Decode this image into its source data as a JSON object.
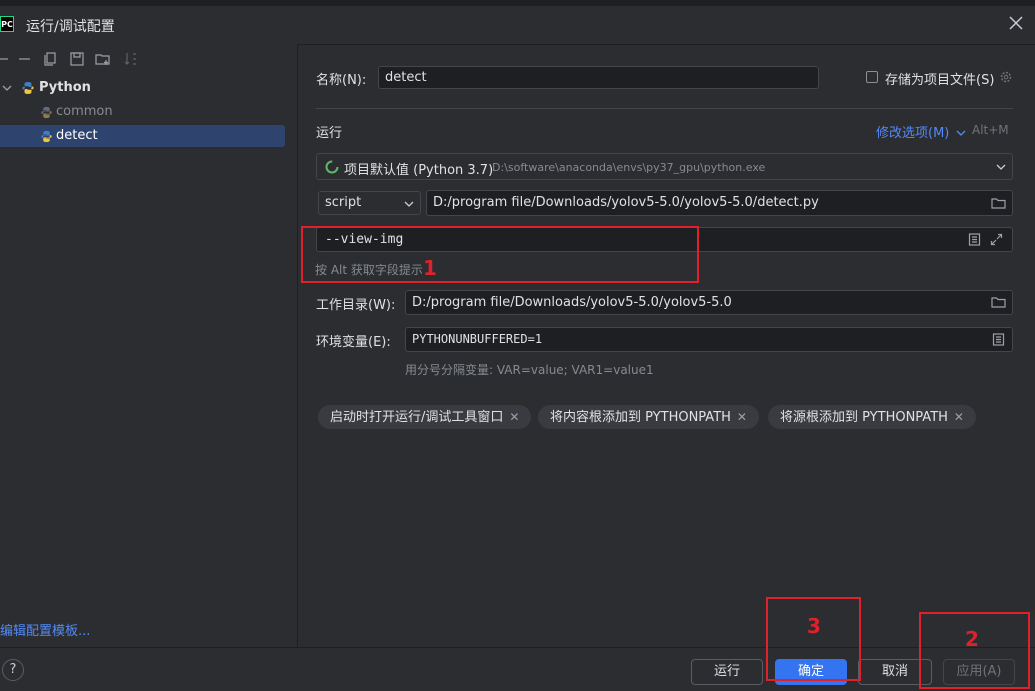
{
  "window": {
    "title": "运行/调试配置",
    "app_icon": "PC"
  },
  "tree": {
    "root": "Python",
    "items": [
      "common",
      "detect"
    ],
    "selected": "detect"
  },
  "left_footer": {
    "edit_templates": "编辑配置模板..."
  },
  "form": {
    "name_label": "名称(N):",
    "name_value": "detect",
    "store_as_file": "存储为项目文件(S)",
    "run_section": "运行",
    "modify_options": "修改选项(M)",
    "modify_shortcut": "Alt+M",
    "interpreter_label": "项目默认值 (Python 3.7)",
    "interpreter_path": "D:\\software\\anaconda\\envs\\py37_gpu\\python.exe",
    "script_type": "script",
    "script_path": "D:/program file/Downloads/yolov5-5.0/yolov5-5.0/detect.py",
    "params_value": "--view-img",
    "params_hint": "按 Alt 获取字段提示",
    "workdir_label": "工作目录(W):",
    "workdir_value": "D:/program file/Downloads/yolov5-5.0/yolov5-5.0",
    "env_label": "环境变量(E):",
    "env_value": "PYTHONUNBUFFERED=1",
    "env_hint": "用分号分隔变量: VAR=value; VAR1=value1",
    "chips": [
      "启动时打开运行/调试工具窗口",
      "将内容根添加到 PYTHONPATH",
      "将源根添加到 PYTHONPATH"
    ]
  },
  "buttons": {
    "run": "运行",
    "ok": "确定",
    "cancel": "取消",
    "apply": "应用(A)",
    "help": "?"
  },
  "annotations": [
    "1",
    "2",
    "3"
  ],
  "colors": {
    "accent": "#3574f0",
    "highlight": "#e0202a",
    "link": "#548af7",
    "selection": "#2e436e"
  }
}
